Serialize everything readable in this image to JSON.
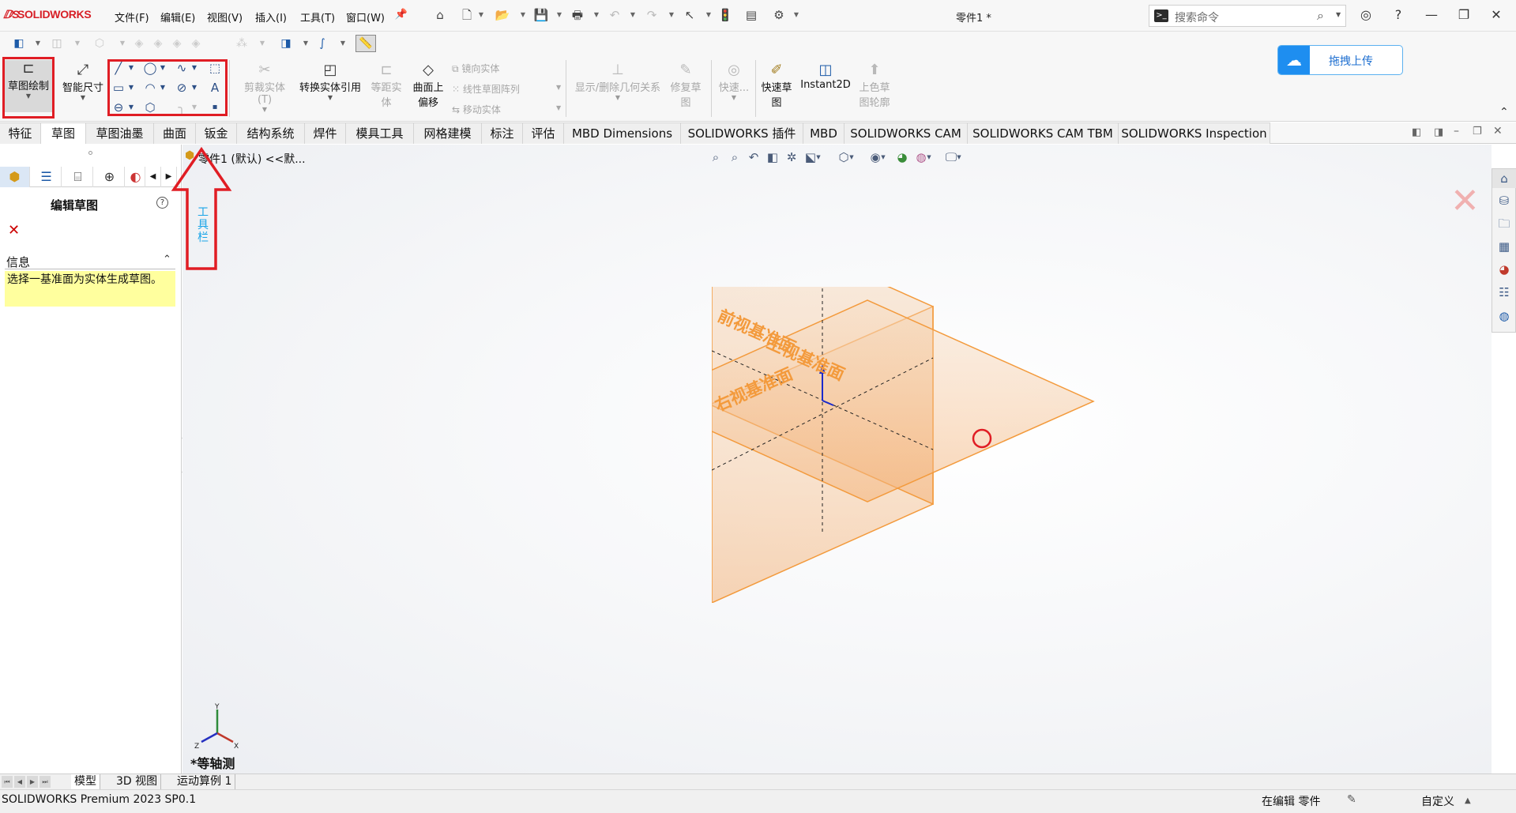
{
  "app": {
    "logo_text": "SOLIDWORKS",
    "document_title": "零件1 *"
  },
  "menu": [
    "文件(F)",
    "编辑(E)",
    "视图(V)",
    "插入(I)",
    "工具(T)",
    "窗口(W)"
  ],
  "search": {
    "placeholder": "搜索命令",
    "terminal_glyph": ">_"
  },
  "window_controls": {
    "minimize": "—",
    "restore": "❐",
    "close": "✕"
  },
  "upload_button": {
    "label": "拖拽上传"
  },
  "command_manager": {
    "sketch_button": "草图绘制",
    "smart_dimension": "智能尺寸",
    "trim": "剪裁实体(T)",
    "convert": "转换实体引用",
    "offset": [
      "等距实",
      "体"
    ],
    "offset_surface": [
      "曲面上",
      "偏移"
    ],
    "mirror": "镜向实体",
    "linear_pattern": "线性草图阵列",
    "move": "移动实体",
    "relations": "显示/删除几何关系",
    "repair": [
      "修复草",
      "图"
    ],
    "quick_snaps": "快速...",
    "rapid_sketch": [
      "快速草",
      "图"
    ],
    "instant2d": "Instant2D",
    "shaded_contours": [
      "上色草",
      "图轮廓"
    ]
  },
  "tabs": [
    "特征",
    "草图",
    "草图油墨",
    "曲面",
    "钣金",
    "结构系统",
    "焊件",
    "模具工具",
    "网格建模",
    "标注",
    "评估",
    "MBD Dimensions",
    "SOLIDWORKS 插件",
    "MBD",
    "SOLIDWORKS CAM",
    "SOLIDWORKS CAM TBM",
    "SOLIDWORKS Inspection"
  ],
  "active_tab": "草图",
  "property_manager": {
    "title": "编辑草图",
    "help": "?",
    "info_header": "信息",
    "info_message": "选择一基准面为实体生成草图。"
  },
  "feature_tree": {
    "root_label": "零件1 (默认) <<默..."
  },
  "viewport": {
    "annotation_label": "工具栏",
    "view_name": "*等轴测",
    "planes": [
      "前视基准面",
      "上视基准面",
      "右视基准面"
    ],
    "plane_color": "#f39a3c",
    "annotation_color": "#e01d24",
    "triad_axes": [
      "X",
      "Y",
      "Z"
    ]
  },
  "bottom_tabs": [
    "模型",
    "3D 视图",
    "运动算例 1"
  ],
  "status": {
    "product": "SOLIDWORKS Premium 2023 SP0.1",
    "editing": "在编辑 零件",
    "custom": "自定义"
  }
}
